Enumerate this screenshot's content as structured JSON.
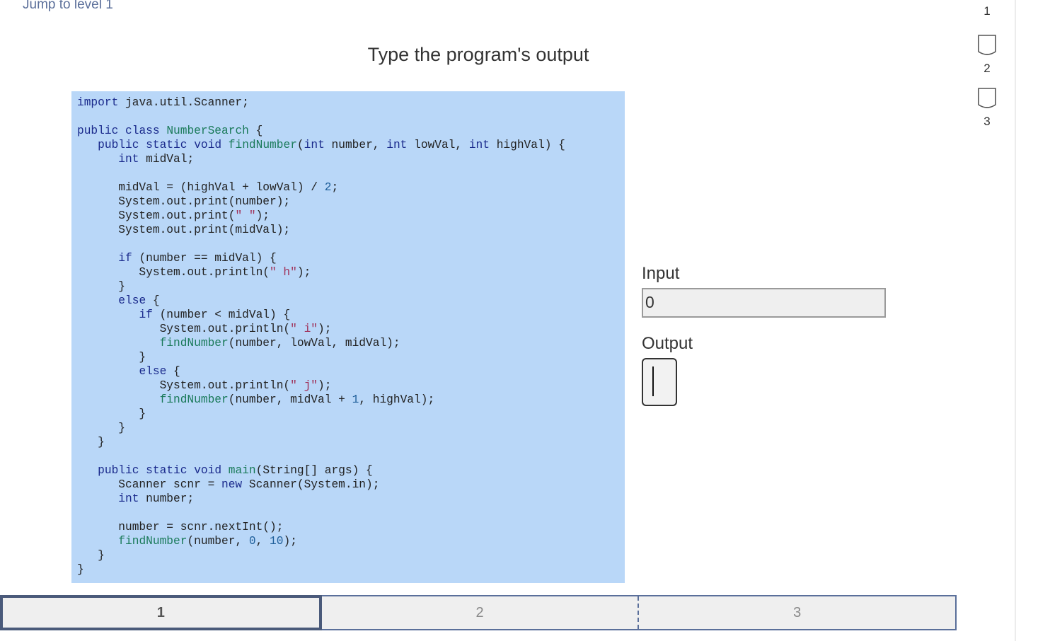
{
  "header": {
    "jump_link": "Jump to level 1",
    "title": "Type the program's output"
  },
  "code": {
    "lines": [
      "import java.util.Scanner;",
      "",
      "public class NumberSearch {",
      "   public static void findNumber(int number, int lowVal, int highVal) {",
      "      int midVal;",
      "",
      "      midVal = (highVal + lowVal) / 2;",
      "      System.out.print(number);",
      "      System.out.print(\" \");",
      "      System.out.print(midVal);",
      "",
      "      if (number == midVal) {",
      "         System.out.println(\" h\");",
      "      }",
      "      else {",
      "         if (number < midVal) {",
      "            System.out.println(\" i\");",
      "            findNumber(number, lowVal, midVal);",
      "         }",
      "         else {",
      "            System.out.println(\" j\");",
      "            findNumber(number, midVal + 1, highVal);",
      "         }",
      "      }",
      "   }",
      "",
      "   public static void main(String[] args) {",
      "      Scanner scnr = new Scanner(System.in);",
      "      int number;",
      "",
      "      number = scnr.nextInt();",
      "      findNumber(number, 0, 10);",
      "   }",
      "}"
    ]
  },
  "io": {
    "input_label": "Input",
    "input_value": "0",
    "output_label": "Output",
    "output_value": ""
  },
  "levels": [
    {
      "number": "1",
      "icon": "level-badge-icon"
    },
    {
      "number": "2",
      "icon": "level-badge-icon"
    },
    {
      "number": "3",
      "icon": "level-badge-icon"
    }
  ],
  "steps": [
    {
      "label": "1",
      "active": true
    },
    {
      "label": "2",
      "active": false
    },
    {
      "label": "3",
      "active": false
    }
  ],
  "colors": {
    "code_background": "#b9d7f8",
    "keyword": "#1a2a8c",
    "step_border": "#5a6f9a"
  }
}
